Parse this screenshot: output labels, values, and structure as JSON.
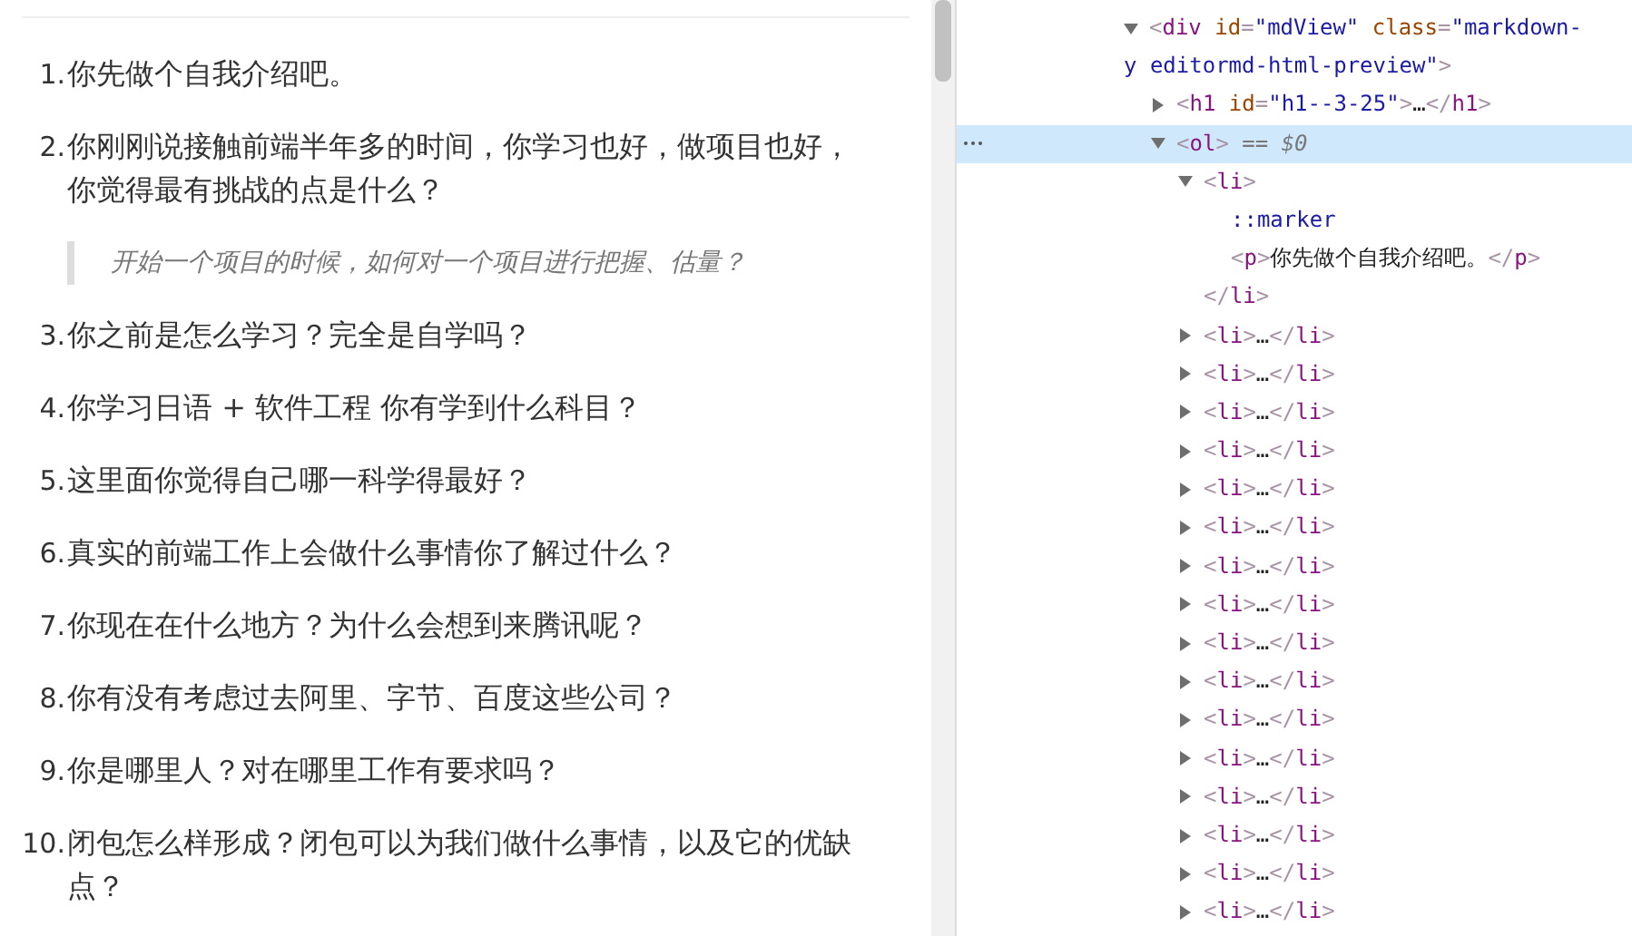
{
  "article": {
    "items": [
      {
        "number": "1.",
        "text": "你先做个自我介绍吧。"
      },
      {
        "number": "2.",
        "text": "你刚刚说接触前端半年多的时间，你学习也好，做项目也好，你觉得最有挑战的点是什么？",
        "quote": "开始一个项目的时候，如何对一个项目进行把握、估量？"
      },
      {
        "number": "3.",
        "text": "你之前是怎么学习？完全是自学吗？"
      },
      {
        "number": "4.",
        "text": "你学习日语 + 软件工程 你有学到什么科目？"
      },
      {
        "number": "5.",
        "text": "这里面你觉得自己哪一科学得最好？"
      },
      {
        "number": "6.",
        "text": "真实的前端工作上会做什么事情你了解过什么？"
      },
      {
        "number": "7.",
        "text": "你现在在什么地方？为什么会想到来腾讯呢？"
      },
      {
        "number": "8.",
        "text": "你有没有考虑过去阿里、字节、百度这些公司？"
      },
      {
        "number": "9.",
        "text": "你是哪里人？对在哪里工作有要求吗？"
      },
      {
        "number": "10.",
        "text": "闭包怎么样形成？闭包可以为我们做什么事情，以及它的优缺点？"
      }
    ]
  },
  "elements_panel": {
    "tree": [
      {
        "expanded": true,
        "selected": false,
        "tokens": [
          {
            "kind": "punct",
            "text": "<"
          },
          {
            "kind": "tag",
            "text": "div"
          },
          {
            "kind": "attr",
            "text": " id"
          },
          {
            "kind": "punct",
            "text": "="
          },
          {
            "kind": "value",
            "text": "\"mdView\""
          },
          {
            "kind": "attr",
            "text": " class"
          },
          {
            "kind": "punct",
            "text": "="
          },
          {
            "kind": "value",
            "text": "\"markdown-"
          }
        ],
        "wrap": [
          {
            "kind": "value",
            "text": "y editormd-html-preview\""
          },
          {
            "kind": "punct",
            "text": ">"
          }
        ],
        "children": [
          {
            "expanded": false,
            "selected": false,
            "tokens": [
              {
                "kind": "punct",
                "text": "<"
              },
              {
                "kind": "tag",
                "text": "h1"
              },
              {
                "kind": "attr",
                "text": " id"
              },
              {
                "kind": "punct",
                "text": "="
              },
              {
                "kind": "value",
                "text": "\"h1--3-25\""
              },
              {
                "kind": "punct",
                "text": ">"
              },
              {
                "kind": "text",
                "text": "…"
              },
              {
                "kind": "punct",
                "text": "</"
              },
              {
                "kind": "tag",
                "text": "h1"
              },
              {
                "kind": "punct",
                "text": ">"
              }
            ]
          },
          {
            "expanded": true,
            "selected": true,
            "tokens": [
              {
                "kind": "punct",
                "text": "<"
              },
              {
                "kind": "tag",
                "text": "ol"
              },
              {
                "kind": "punct",
                "text": ">"
              },
              {
                "kind": "console",
                "text": " == "
              },
              {
                "kind": "console_var",
                "text": "$0"
              }
            ],
            "children": [
              {
                "expanded": true,
                "selected": false,
                "tokens": [
                  {
                    "kind": "punct",
                    "text": "<"
                  },
                  {
                    "kind": "tag",
                    "text": "li"
                  },
                  {
                    "kind": "punct",
                    "text": ">"
                  }
                ],
                "children": [
                  {
                    "selected": false,
                    "tokens": [
                      {
                        "kind": "pseudo",
                        "text": "::marker"
                      }
                    ]
                  },
                  {
                    "selected": false,
                    "tokens": [
                      {
                        "kind": "punct",
                        "text": "<"
                      },
                      {
                        "kind": "tag",
                        "text": "p"
                      },
                      {
                        "kind": "punct",
                        "text": ">"
                      },
                      {
                        "kind": "text",
                        "text": "你先做个自我介绍吧。"
                      },
                      {
                        "kind": "punct",
                        "text": "</"
                      },
                      {
                        "kind": "tag",
                        "text": "p"
                      },
                      {
                        "kind": "punct",
                        "text": ">"
                      }
                    ]
                  }
                ],
                "closing": [
                  {
                    "kind": "punct",
                    "text": "</"
                  },
                  {
                    "kind": "tag",
                    "text": "li"
                  },
                  {
                    "kind": "punct",
                    "text": ">"
                  }
                ]
              },
              {
                "expanded": false,
                "selected": false,
                "tokens": [
                  {
                    "kind": "punct",
                    "text": "<"
                  },
                  {
                    "kind": "tag",
                    "text": "li"
                  },
                  {
                    "kind": "punct",
                    "text": ">"
                  },
                  {
                    "kind": "text",
                    "text": "…"
                  },
                  {
                    "kind": "punct",
                    "text": "</"
                  },
                  {
                    "kind": "tag",
                    "text": "li"
                  },
                  {
                    "kind": "punct",
                    "text": ">"
                  }
                ]
              },
              {
                "expanded": false,
                "selected": false,
                "tokens": [
                  {
                    "kind": "punct",
                    "text": "<"
                  },
                  {
                    "kind": "tag",
                    "text": "li"
                  },
                  {
                    "kind": "punct",
                    "text": ">"
                  },
                  {
                    "kind": "text",
                    "text": "…"
                  },
                  {
                    "kind": "punct",
                    "text": "</"
                  },
                  {
                    "kind": "tag",
                    "text": "li"
                  },
                  {
                    "kind": "punct",
                    "text": ">"
                  }
                ]
              },
              {
                "expanded": false,
                "selected": false,
                "tokens": [
                  {
                    "kind": "punct",
                    "text": "<"
                  },
                  {
                    "kind": "tag",
                    "text": "li"
                  },
                  {
                    "kind": "punct",
                    "text": ">"
                  },
                  {
                    "kind": "text",
                    "text": "…"
                  },
                  {
                    "kind": "punct",
                    "text": "</"
                  },
                  {
                    "kind": "tag",
                    "text": "li"
                  },
                  {
                    "kind": "punct",
                    "text": ">"
                  }
                ]
              },
              {
                "expanded": false,
                "selected": false,
                "tokens": [
                  {
                    "kind": "punct",
                    "text": "<"
                  },
                  {
                    "kind": "tag",
                    "text": "li"
                  },
                  {
                    "kind": "punct",
                    "text": ">"
                  },
                  {
                    "kind": "text",
                    "text": "…"
                  },
                  {
                    "kind": "punct",
                    "text": "</"
                  },
                  {
                    "kind": "tag",
                    "text": "li"
                  },
                  {
                    "kind": "punct",
                    "text": ">"
                  }
                ]
              },
              {
                "expanded": false,
                "selected": false,
                "tokens": [
                  {
                    "kind": "punct",
                    "text": "<"
                  },
                  {
                    "kind": "tag",
                    "text": "li"
                  },
                  {
                    "kind": "punct",
                    "text": ">"
                  },
                  {
                    "kind": "text",
                    "text": "…"
                  },
                  {
                    "kind": "punct",
                    "text": "</"
                  },
                  {
                    "kind": "tag",
                    "text": "li"
                  },
                  {
                    "kind": "punct",
                    "text": ">"
                  }
                ]
              },
              {
                "expanded": false,
                "selected": false,
                "tokens": [
                  {
                    "kind": "punct",
                    "text": "<"
                  },
                  {
                    "kind": "tag",
                    "text": "li"
                  },
                  {
                    "kind": "punct",
                    "text": ">"
                  },
                  {
                    "kind": "text",
                    "text": "…"
                  },
                  {
                    "kind": "punct",
                    "text": "</"
                  },
                  {
                    "kind": "tag",
                    "text": "li"
                  },
                  {
                    "kind": "punct",
                    "text": ">"
                  }
                ]
              },
              {
                "expanded": false,
                "selected": false,
                "tokens": [
                  {
                    "kind": "punct",
                    "text": "<"
                  },
                  {
                    "kind": "tag",
                    "text": "li"
                  },
                  {
                    "kind": "punct",
                    "text": ">"
                  },
                  {
                    "kind": "text",
                    "text": "…"
                  },
                  {
                    "kind": "punct",
                    "text": "</"
                  },
                  {
                    "kind": "tag",
                    "text": "li"
                  },
                  {
                    "kind": "punct",
                    "text": ">"
                  }
                ]
              },
              {
                "expanded": false,
                "selected": false,
                "tokens": [
                  {
                    "kind": "punct",
                    "text": "<"
                  },
                  {
                    "kind": "tag",
                    "text": "li"
                  },
                  {
                    "kind": "punct",
                    "text": ">"
                  },
                  {
                    "kind": "text",
                    "text": "…"
                  },
                  {
                    "kind": "punct",
                    "text": "</"
                  },
                  {
                    "kind": "tag",
                    "text": "li"
                  },
                  {
                    "kind": "punct",
                    "text": ">"
                  }
                ]
              },
              {
                "expanded": false,
                "selected": false,
                "tokens": [
                  {
                    "kind": "punct",
                    "text": "<"
                  },
                  {
                    "kind": "tag",
                    "text": "li"
                  },
                  {
                    "kind": "punct",
                    "text": ">"
                  },
                  {
                    "kind": "text",
                    "text": "…"
                  },
                  {
                    "kind": "punct",
                    "text": "</"
                  },
                  {
                    "kind": "tag",
                    "text": "li"
                  },
                  {
                    "kind": "punct",
                    "text": ">"
                  }
                ]
              },
              {
                "expanded": false,
                "selected": false,
                "tokens": [
                  {
                    "kind": "punct",
                    "text": "<"
                  },
                  {
                    "kind": "tag",
                    "text": "li"
                  },
                  {
                    "kind": "punct",
                    "text": ">"
                  },
                  {
                    "kind": "text",
                    "text": "…"
                  },
                  {
                    "kind": "punct",
                    "text": "</"
                  },
                  {
                    "kind": "tag",
                    "text": "li"
                  },
                  {
                    "kind": "punct",
                    "text": ">"
                  }
                ]
              },
              {
                "expanded": false,
                "selected": false,
                "tokens": [
                  {
                    "kind": "punct",
                    "text": "<"
                  },
                  {
                    "kind": "tag",
                    "text": "li"
                  },
                  {
                    "kind": "punct",
                    "text": ">"
                  },
                  {
                    "kind": "text",
                    "text": "…"
                  },
                  {
                    "kind": "punct",
                    "text": "</"
                  },
                  {
                    "kind": "tag",
                    "text": "li"
                  },
                  {
                    "kind": "punct",
                    "text": ">"
                  }
                ]
              },
              {
                "expanded": false,
                "selected": false,
                "tokens": [
                  {
                    "kind": "punct",
                    "text": "<"
                  },
                  {
                    "kind": "tag",
                    "text": "li"
                  },
                  {
                    "kind": "punct",
                    "text": ">"
                  },
                  {
                    "kind": "text",
                    "text": "…"
                  },
                  {
                    "kind": "punct",
                    "text": "</"
                  },
                  {
                    "kind": "tag",
                    "text": "li"
                  },
                  {
                    "kind": "punct",
                    "text": ">"
                  }
                ]
              },
              {
                "expanded": false,
                "selected": false,
                "tokens": [
                  {
                    "kind": "punct",
                    "text": "<"
                  },
                  {
                    "kind": "tag",
                    "text": "li"
                  },
                  {
                    "kind": "punct",
                    "text": ">"
                  },
                  {
                    "kind": "text",
                    "text": "…"
                  },
                  {
                    "kind": "punct",
                    "text": "</"
                  },
                  {
                    "kind": "tag",
                    "text": "li"
                  },
                  {
                    "kind": "punct",
                    "text": ">"
                  }
                ]
              },
              {
                "expanded": false,
                "selected": false,
                "tokens": [
                  {
                    "kind": "punct",
                    "text": "<"
                  },
                  {
                    "kind": "tag",
                    "text": "li"
                  },
                  {
                    "kind": "punct",
                    "text": ">"
                  },
                  {
                    "kind": "text",
                    "text": "…"
                  },
                  {
                    "kind": "punct",
                    "text": "</"
                  },
                  {
                    "kind": "tag",
                    "text": "li"
                  },
                  {
                    "kind": "punct",
                    "text": ">"
                  }
                ]
              },
              {
                "expanded": false,
                "selected": false,
                "tokens": [
                  {
                    "kind": "punct",
                    "text": "<"
                  },
                  {
                    "kind": "tag",
                    "text": "li"
                  },
                  {
                    "kind": "punct",
                    "text": ">"
                  },
                  {
                    "kind": "text",
                    "text": "…"
                  },
                  {
                    "kind": "punct",
                    "text": "</"
                  },
                  {
                    "kind": "tag",
                    "text": "li"
                  },
                  {
                    "kind": "punct",
                    "text": ">"
                  }
                ]
              },
              {
                "expanded": false,
                "selected": false,
                "tokens": [
                  {
                    "kind": "punct",
                    "text": "<"
                  },
                  {
                    "kind": "tag",
                    "text": "li"
                  },
                  {
                    "kind": "punct",
                    "text": ">"
                  },
                  {
                    "kind": "text",
                    "text": "…"
                  },
                  {
                    "kind": "punct",
                    "text": "</"
                  },
                  {
                    "kind": "tag",
                    "text": "li"
                  },
                  {
                    "kind": "punct",
                    "text": ">"
                  }
                ]
              }
            ]
          }
        ]
      }
    ]
  }
}
